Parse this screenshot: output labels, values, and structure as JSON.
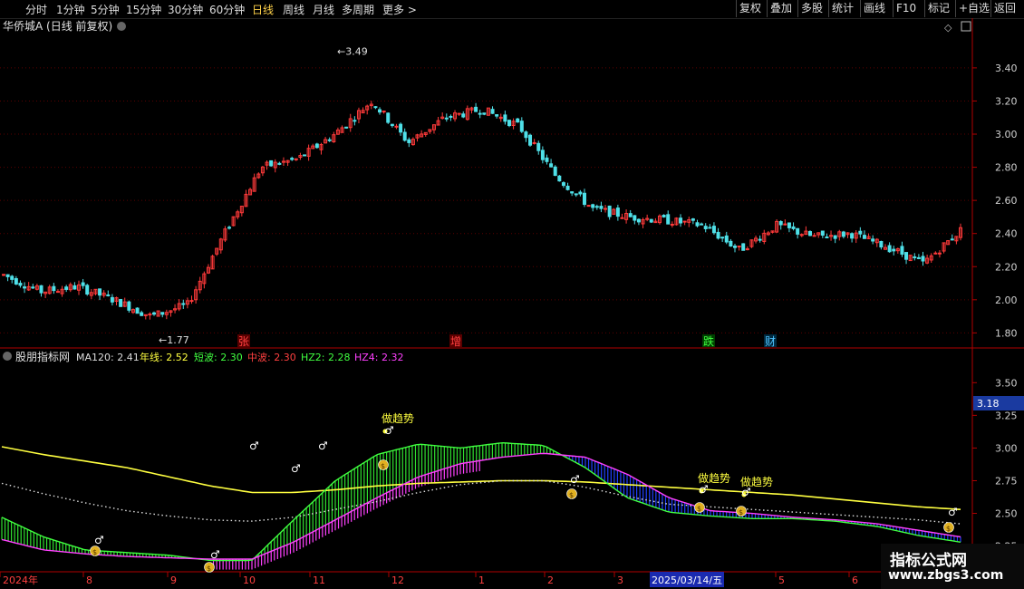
{
  "toolbar": {
    "timeframes": [
      "分时",
      "1分钟",
      "5分钟",
      "15分钟",
      "30分钟",
      "60分钟",
      "日线",
      "周线",
      "月线",
      "多周期",
      "更多 >"
    ],
    "active_timeframe": "日线",
    "tools": [
      "复权",
      "叠加",
      "多股",
      "统计",
      "画线",
      "F10",
      "标记",
      "+自选",
      "返回"
    ]
  },
  "price_panel": {
    "title": "华侨城A (日线 前复权)",
    "high_label": "3.49",
    "low_label": "1.77",
    "markers": [
      {
        "text": "张",
        "color": "#ff4040",
        "bg": "#5a0000"
      },
      {
        "text": "增",
        "color": "#ff4040",
        "bg": "#5a0000"
      },
      {
        "text": "跌",
        "color": "#40ff40",
        "bg": "#004000"
      },
      {
        "text": "财",
        "color": "#4fc3ff",
        "bg": "#002a40"
      }
    ]
  },
  "indicator_panel": {
    "name": "股朋指标网",
    "values": [
      {
        "label": "MA120: 2.41",
        "color": "#dddddd"
      },
      {
        "label": "年线: 2.52",
        "color": "#ffff40"
      },
      {
        "label": "短波: 2.30",
        "color": "#40ff40"
      },
      {
        "label": "中波: 2.30",
        "color": "#ff4040"
      },
      {
        "label": "HZ2: 2.28",
        "color": "#40ff40"
      },
      {
        "label": "HZ4: 2.32",
        "color": "#ff40ff"
      }
    ],
    "current_value_tag": "3.18",
    "annotations": [
      "做趋势",
      "做趋势",
      "做趋势"
    ]
  },
  "time_axis": {
    "labels": [
      "2024年",
      "8",
      "9",
      "10",
      "11",
      "12",
      "1",
      "2",
      "3",
      "2025/03/14/五",
      "5",
      "6"
    ]
  },
  "watermark": {
    "title": "指标公式网",
    "url": "www.zbgs3.com"
  },
  "chart_data": [
    {
      "type": "candlestick",
      "title": "华侨城A (日线 前复权)",
      "y_axis_ticks": [
        "3.40",
        "3.20",
        "3.00",
        "2.80",
        "2.60",
        "2.40",
        "2.20",
        "2.00",
        "1.80"
      ],
      "ylim": [
        1.72,
        3.58
      ],
      "series": [
        {
          "name": "价格走势(收盘近似)",
          "x": [
            "2024-07",
            "2024-08",
            "2024-08",
            "2024-09",
            "2024-09",
            "2024-09",
            "2024-10",
            "2024-10",
            "2024-10",
            "2024-11",
            "2024-11",
            "2024-11",
            "2024-12",
            "2024-12",
            "2025-01",
            "2025-01",
            "2025-02",
            "2025-02",
            "2025-03",
            "2025-03",
            "2025-04",
            "2025-04",
            "2025-05",
            "2025-05",
            "2025-06",
            "2025-06",
            "2025-06"
          ],
          "values": [
            2.15,
            2.05,
            2.08,
            2.0,
            1.9,
            1.97,
            2.4,
            2.8,
            2.85,
            3.0,
            3.2,
            2.95,
            3.1,
            3.15,
            3.05,
            2.75,
            2.55,
            2.5,
            2.48,
            2.45,
            2.3,
            2.45,
            2.38,
            2.4,
            2.32,
            2.22,
            2.42
          ]
        }
      ],
      "high": 3.49,
      "low": 1.77
    },
    {
      "type": "line",
      "title": "股朋指标网",
      "y_axis_ticks": [
        "3.50",
        "3.25",
        "3.00",
        "2.75",
        "2.50",
        "2.25"
      ],
      "ylim": [
        2.06,
        3.62
      ],
      "series": [
        {
          "name": "年线",
          "color": "#ffff40",
          "values": [
            3.01,
            2.95,
            2.9,
            2.85,
            2.78,
            2.71,
            2.66,
            2.66,
            2.68,
            2.71,
            2.73,
            2.74,
            2.75,
            2.75,
            2.74,
            2.72,
            2.7,
            2.68,
            2.66,
            2.64,
            2.61,
            2.58,
            2.55,
            2.53
          ]
        },
        {
          "name": "MA120",
          "color": "#dddddd",
          "values": [
            2.73,
            2.65,
            2.58,
            2.52,
            2.48,
            2.45,
            2.44,
            2.47,
            2.53,
            2.59,
            2.66,
            2.72,
            2.75,
            2.75,
            2.7,
            2.63,
            2.57,
            2.55,
            2.53,
            2.51,
            2.49,
            2.47,
            2.45,
            2.42
          ]
        },
        {
          "name": "短波",
          "color": "#40ff40",
          "values": [
            2.47,
            2.32,
            2.22,
            2.2,
            2.18,
            2.14,
            2.14,
            2.45,
            2.75,
            2.95,
            3.03,
            3.0,
            3.04,
            3.02,
            2.85,
            2.62,
            2.51,
            2.48,
            2.46,
            2.46,
            2.44,
            2.4,
            2.33,
            2.28
          ]
        },
        {
          "name": "中波",
          "color": "#ff40ff",
          "values": [
            2.3,
            2.22,
            2.19,
            2.17,
            2.16,
            2.15,
            2.15,
            2.28,
            2.45,
            2.62,
            2.78,
            2.88,
            2.93,
            2.96,
            2.93,
            2.8,
            2.62,
            2.52,
            2.5,
            2.47,
            2.45,
            2.42,
            2.37,
            2.32
          ]
        }
      ]
    }
  ]
}
